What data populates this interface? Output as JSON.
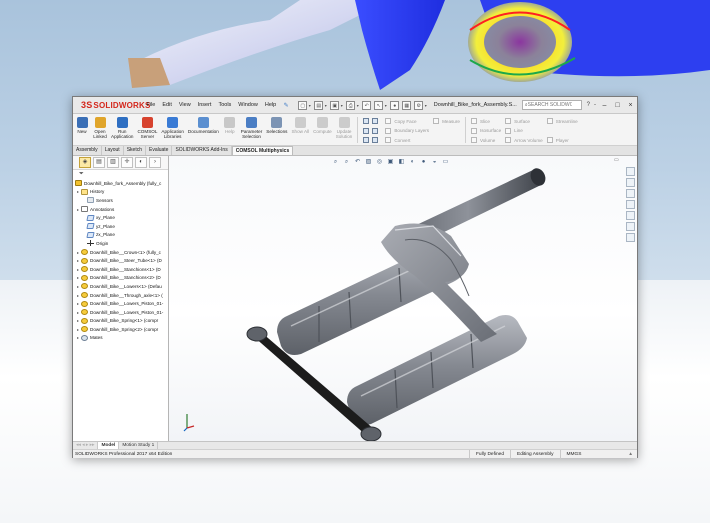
{
  "app": {
    "brand": "SOLIDWORKS",
    "menu": [
      "File",
      "Edit",
      "View",
      "Insert",
      "Tools",
      "Window",
      "Help"
    ],
    "document_title": "Downhill_Bike_fork_Assembly.S...",
    "search_placeholder": "SEARCH SOLIDWORKS Help",
    "window_controls": [
      "–",
      "□",
      "×"
    ],
    "window_extra": [
      "?",
      "-"
    ]
  },
  "ribbon": {
    "buttons": [
      {
        "label": "New",
        "icon": "new-doc-icon",
        "color": "#3b6fb6"
      },
      {
        "label": "Open\nLinked",
        "icon": "open-folder-icon",
        "color": "#e0a52b"
      },
      {
        "label": "Run\nApplication",
        "icon": "run-app-icon",
        "color": "#2f6fc2"
      },
      {
        "label": "COMSOL\nServer",
        "icon": "comsol-server-icon",
        "color": "#d7432f"
      },
      {
        "label": "Application\nLibraries",
        "icon": "app-libraries-icon",
        "color": "#3a7bd5"
      },
      {
        "label": "Documentation",
        "icon": "documentation-icon",
        "color": "#5b8fd0"
      },
      {
        "label": "Help",
        "icon": "help-icon",
        "color": "#c8c8c8",
        "disabled": true
      },
      {
        "label": "Parameter\nSelection",
        "icon": "parameter-selection-icon",
        "color": "#4b7ec4"
      },
      {
        "label": "Selections",
        "icon": "selections-icon",
        "color": "#7c94b4"
      },
      {
        "label": "Show All",
        "icon": "show-all-icon",
        "color": "#cccccc",
        "disabled": true
      },
      {
        "label": "Compute",
        "icon": "compute-icon",
        "color": "#cccccc",
        "disabled": true
      },
      {
        "label": "Update\nSolution",
        "icon": "update-solution-icon",
        "color": "#cccccc",
        "disabled": true
      }
    ],
    "list1": [
      "Copy Face",
      "Boundary Layers",
      "Convert"
    ],
    "list2": [
      "Measure"
    ],
    "list3": [
      "Slice",
      "Isosurface",
      "Volume"
    ],
    "list4": [
      "Surface",
      "Line",
      "Arrow Volume"
    ],
    "list5": [
      "Streamline",
      "Player"
    ]
  },
  "command_tabs": [
    {
      "label": "Assembly",
      "active": false
    },
    {
      "label": "Layout",
      "active": false
    },
    {
      "label": "Sketch",
      "active": false
    },
    {
      "label": "Evaluate",
      "active": false
    },
    {
      "label": "SOLIDWORKS Add-Ins",
      "active": false
    },
    {
      "label": "COMSOL Multiphysics",
      "active": true
    }
  ],
  "tree": {
    "root": "Downhill_Bike_fork_Assembly  (fully_c",
    "items": [
      {
        "label": "History",
        "icon": "folder",
        "expand": "▸"
      },
      {
        "label": "Sensors",
        "icon": "sensor",
        "expand": ""
      },
      {
        "label": "Annotations",
        "icon": "anno",
        "expand": "▸"
      },
      {
        "label": "xy_Plane",
        "icon": "plane",
        "expand": ""
      },
      {
        "label": "yz_Plane",
        "icon": "plane",
        "expand": ""
      },
      {
        "label": "zx_Plane",
        "icon": "plane",
        "expand": ""
      },
      {
        "label": "Origin",
        "icon": "origin",
        "expand": ""
      },
      {
        "label": "Downhill_Bike__Crown<1> (fully_c",
        "icon": "part",
        "expand": "▸"
      },
      {
        "label": "Downhill_Bike__Steer_Tube<1> (D",
        "icon": "part",
        "expand": "▸"
      },
      {
        "label": "Downhill_Bike__Stanchions<1> (D",
        "icon": "part",
        "expand": "▸"
      },
      {
        "label": "Downhill_Bike__Stanchions<2> (D",
        "icon": "part",
        "expand": "▸"
      },
      {
        "label": "Downhill_Bike__Lowers<1> (Defau",
        "icon": "part",
        "expand": "▸"
      },
      {
        "label": "Downhill_Bike__Through_axle<1> (",
        "icon": "part",
        "expand": "▸"
      },
      {
        "label": "Downhill_Bike__Lowers_Piston_01-",
        "icon": "part",
        "expand": "▸"
      },
      {
        "label": "Downhill_Bike__Lowers_Piston_01-",
        "icon": "part",
        "expand": "▸"
      },
      {
        "label": "Downhill_Bike_Spring<1> (compr",
        "icon": "part",
        "expand": "▸"
      },
      {
        "label": "Downhill_Bike_Spring<2> (compr",
        "icon": "part",
        "expand": "▸"
      },
      {
        "label": "Mates",
        "icon": "mates",
        "expand": "▸"
      }
    ]
  },
  "bottom_tabs": [
    {
      "label": "Model",
      "active": true,
      "dim": false
    },
    {
      "label": "Motion Study 1",
      "active": false,
      "dim": false
    }
  ],
  "status": {
    "edition": "SOLIDWORKS Professional 2017 x64 Edition",
    "state": "Fully Defined",
    "mode": "Editing Assembly",
    "units": "MMGS",
    "units_arrow": "▲"
  },
  "colors": {
    "accent_red": "#d4261b",
    "part_gray": "#8d9097",
    "axle_black": "#1c1c1c",
    "stem_dark": "#4a4e55"
  }
}
